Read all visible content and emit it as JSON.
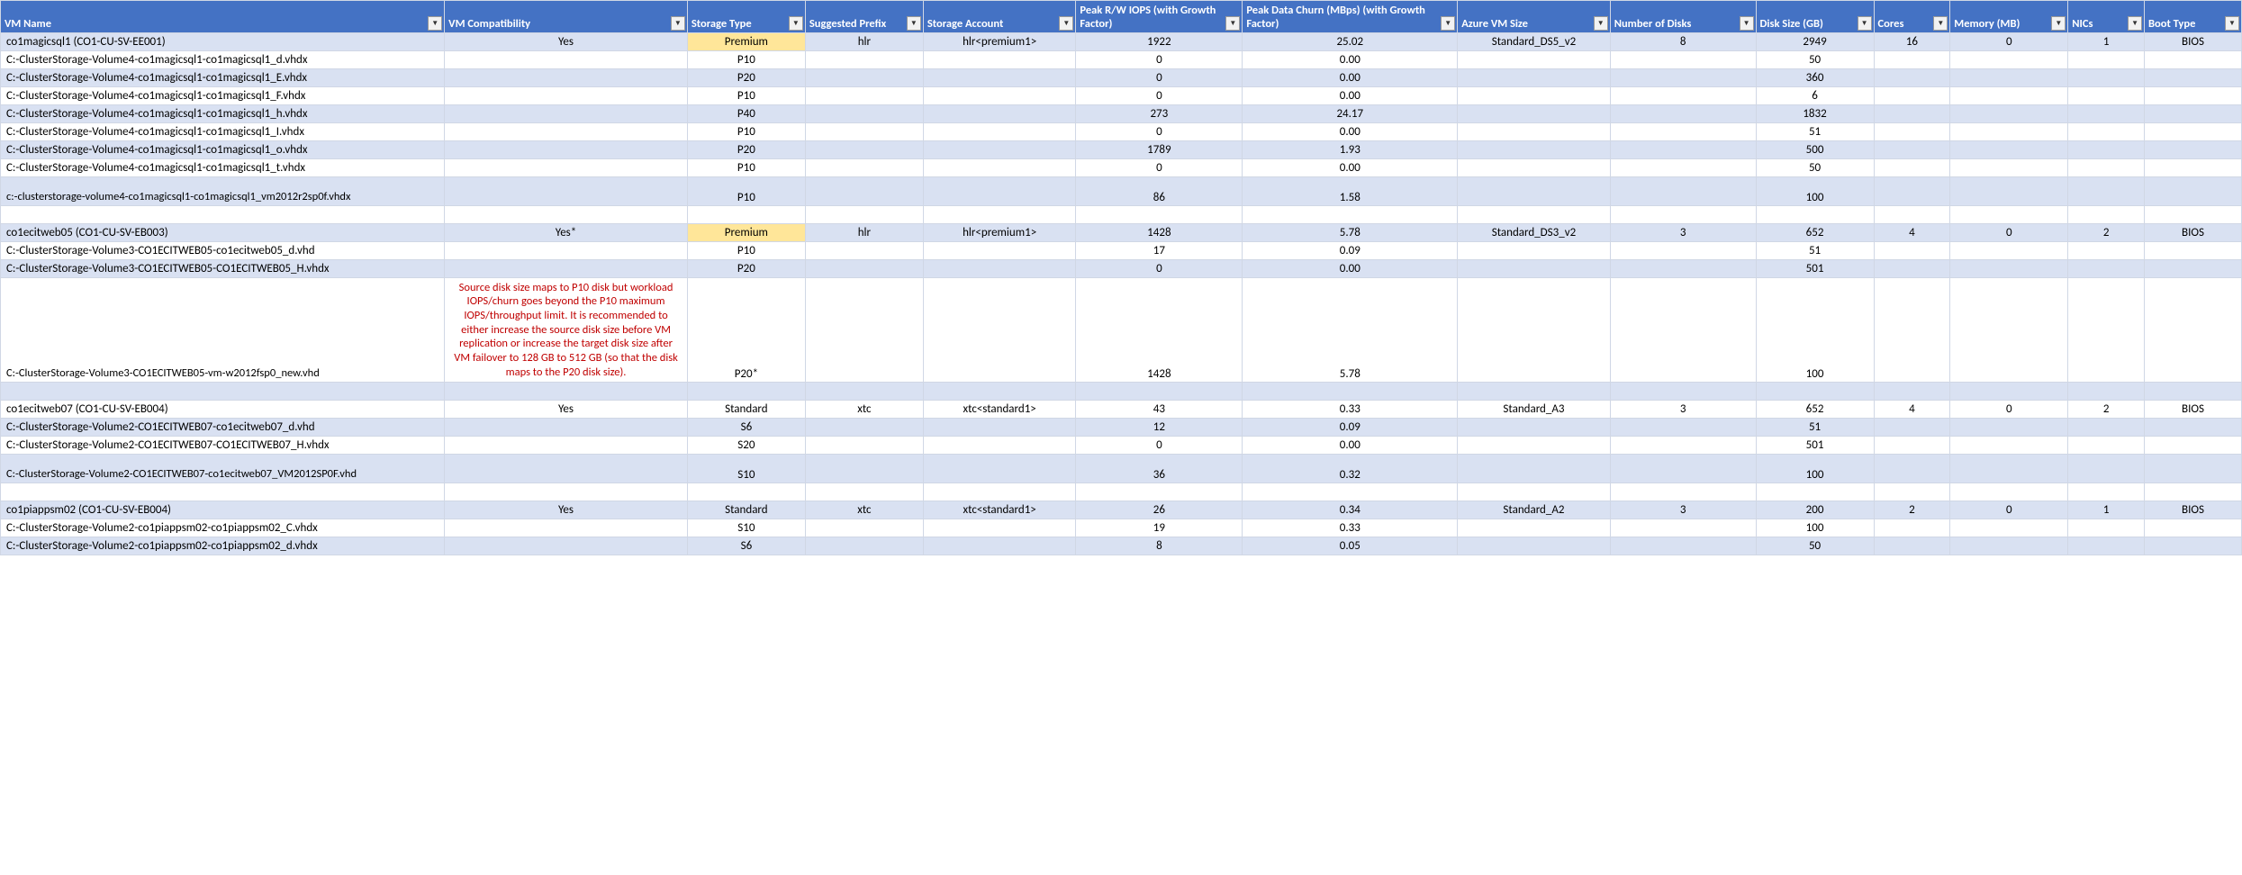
{
  "headers": [
    "VM Name",
    "VM Compatibility",
    "Storage Type",
    "Suggested Prefix",
    "Storage Account",
    "Peak R/W IOPS (with Growth Factor)",
    "Peak Data Churn (MBps) (with Growth Factor)",
    "Azure VM Size",
    "Number of Disks",
    "Disk Size (GB)",
    "Cores",
    "Memory (MB)",
    "NICs",
    "Boot Type"
  ],
  "rows": [
    {
      "cls": "row-even",
      "name": "co1magicsql1 (CO1-CU-SV-EE001)",
      "compat": "Yes",
      "stype": "Premium",
      "premium": true,
      "prefix": "hlr",
      "account": "hlr<premium1>",
      "iops": "1922",
      "churn": "25.02",
      "vmsize": "Standard_DS5_v2",
      "disks": "8",
      "dsize": "2949",
      "cores": "16",
      "mem": "0",
      "nics": "1",
      "boot": "BIOS"
    },
    {
      "cls": "row-odd",
      "name": "  C:-ClusterStorage-Volume4-co1magicsql1-co1magicsql1_d.vhdx",
      "stype": "P10",
      "iops": "0",
      "churn": "0.00",
      "dsize": "50"
    },
    {
      "cls": "row-even",
      "name": "  C:-ClusterStorage-Volume4-co1magicsql1-co1magicsql1_E.vhdx",
      "stype": "P20",
      "iops": "0",
      "churn": "0.00",
      "dsize": "360"
    },
    {
      "cls": "row-odd",
      "name": "  C:-ClusterStorage-Volume4-co1magicsql1-co1magicsql1_F.vhdx",
      "stype": "P10",
      "iops": "0",
      "churn": "0.00",
      "dsize": "6"
    },
    {
      "cls": "row-even",
      "name": "  C:-ClusterStorage-Volume4-co1magicsql1-co1magicsql1_h.vhdx",
      "stype": "P40",
      "iops": "273",
      "churn": "24.17",
      "dsize": "1832"
    },
    {
      "cls": "row-odd",
      "name": "  C:-ClusterStorage-Volume4-co1magicsql1-co1magicsql1_I.vhdx",
      "stype": "P10",
      "iops": "0",
      "churn": "0.00",
      "dsize": "51"
    },
    {
      "cls": "row-even",
      "name": "  C:-ClusterStorage-Volume4-co1magicsql1-co1magicsql1_o.vhdx",
      "stype": "P20",
      "iops": "1789",
      "churn": "1.93",
      "dsize": "500"
    },
    {
      "cls": "row-odd",
      "name": "  C:-ClusterStorage-Volume4-co1magicsql1-co1magicsql1_t.vhdx",
      "stype": "P10",
      "iops": "0",
      "churn": "0.00",
      "dsize": "50"
    },
    {
      "cls": "row-even",
      "multiline": true,
      "name": "  c:-clusterstorage-volume4-co1magicsql1-co1magicsql1_vm2012r2sp0f.vhdx",
      "stype": "P10",
      "iops": "86",
      "churn": "1.58",
      "dsize": "100"
    },
    {
      "cls": "row-odd",
      "blank": true
    },
    {
      "cls": "row-even",
      "name": "co1ecitweb05 (CO1-CU-SV-EB003)",
      "compat": "Yes*",
      "stype": "Premium",
      "premium": true,
      "prefix": "hlr",
      "account": "hlr<premium1>",
      "iops": "1428",
      "churn": "5.78",
      "vmsize": "Standard_DS3_v2",
      "disks": "3",
      "dsize": "652",
      "cores": "4",
      "mem": "0",
      "nics": "2",
      "boot": "BIOS"
    },
    {
      "cls": "row-odd",
      "name": "  C:-ClusterStorage-Volume3-CO1ECITWEB05-co1ecitweb05_d.vhd",
      "stype": "P10",
      "iops": "17",
      "churn": "0.09",
      "dsize": "51"
    },
    {
      "cls": "row-even",
      "name": "  C:-ClusterStorage-Volume3-CO1ECITWEB05-CO1ECITWEB05_H.vhdx",
      "stype": "P20",
      "iops": "0",
      "churn": "0.00",
      "dsize": "501"
    },
    {
      "cls": "row-odd",
      "tall": true,
      "multiline": true,
      "name": "  C:-ClusterStorage-Volume3-CO1ECITWEB05-vm-w2012fsp0_new.vhd",
      "compat": "Source disk size maps to P10 disk but workload IOPS/churn goes beyond the P10 maximum IOPS/throughput limit. It is recommended to either increase the source disk size before VM replication or increase the target disk size after VM failover to 128 GB to 512 GB (so that the disk maps to the P20 disk size).",
      "compat_red": true,
      "stype": "P20*",
      "iops": "1428",
      "churn": "5.78",
      "dsize": "100"
    },
    {
      "cls": "row-even",
      "blank": true
    },
    {
      "cls": "row-odd",
      "name": "co1ecitweb07 (CO1-CU-SV-EB004)",
      "compat": "Yes",
      "stype": "Standard",
      "prefix": "xtc",
      "account": "xtc<standard1>",
      "iops": "43",
      "churn": "0.33",
      "vmsize": "Standard_A3",
      "disks": "3",
      "dsize": "652",
      "cores": "4",
      "mem": "0",
      "nics": "2",
      "boot": "BIOS"
    },
    {
      "cls": "row-even",
      "name": "  C:-ClusterStorage-Volume2-CO1ECITWEB07-co1ecitweb07_d.vhd",
      "stype": "S6",
      "iops": "12",
      "churn": "0.09",
      "dsize": "51"
    },
    {
      "cls": "row-odd",
      "name": "  C:-ClusterStorage-Volume2-CO1ECITWEB07-CO1ECITWEB07_H.vhdx",
      "stype": "S20",
      "iops": "0",
      "churn": "0.00",
      "dsize": "501"
    },
    {
      "cls": "row-even",
      "multiline": true,
      "name": "  C:-ClusterStorage-Volume2-CO1ECITWEB07-co1ecitweb07_VM2012SP0F.vhd",
      "stype": "S10",
      "iops": "36",
      "churn": "0.32",
      "dsize": "100"
    },
    {
      "cls": "row-odd",
      "blank": true
    },
    {
      "cls": "row-even",
      "name": "co1piappsm02 (CO1-CU-SV-EB004)",
      "compat": "Yes",
      "stype": "Standard",
      "prefix": "xtc",
      "account": "xtc<standard1>",
      "iops": "26",
      "churn": "0.34",
      "vmsize": "Standard_A2",
      "disks": "3",
      "dsize": "200",
      "cores": "2",
      "mem": "0",
      "nics": "1",
      "boot": "BIOS"
    },
    {
      "cls": "row-odd",
      "name": "  C:-ClusterStorage-Volume2-co1piappsm02-co1piappsm02_C.vhdx",
      "stype": "S10",
      "iops": "19",
      "churn": "0.33",
      "dsize": "100"
    },
    {
      "cls": "row-even",
      "name": "  C:-ClusterStorage-Volume2-co1piappsm02-co1piappsm02_d.vhdx",
      "stype": "S6",
      "iops": "8",
      "churn": "0.05",
      "dsize": "50"
    }
  ]
}
